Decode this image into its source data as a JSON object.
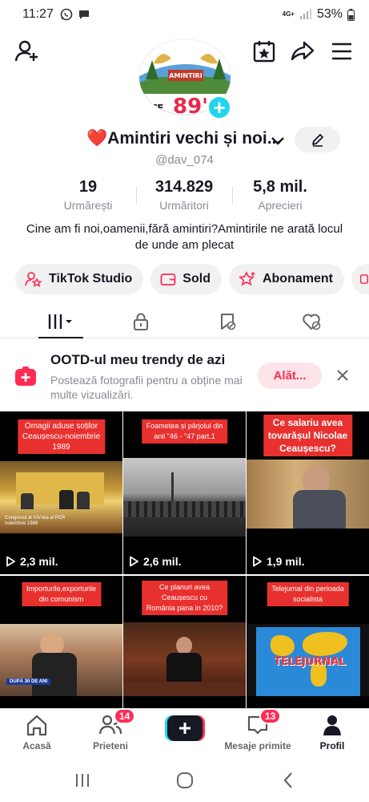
{
  "status_bar": {
    "time": "11:27",
    "network": "4G+",
    "battery": "53%"
  },
  "profile": {
    "display_name": "Amintiri vechi și noi...",
    "name_emoji": "❤️",
    "username": "@dav_074",
    "avatar_text": "89'",
    "avatar_sub": "NTE",
    "avatar_banner": "AMINTIRI",
    "bio": "Cine am fi noi,oamenii,fără amintiri?Amintirile ne arată locul de unde am plecat"
  },
  "stats": [
    {
      "value": "19",
      "label": "Urmărești"
    },
    {
      "value": "314.829",
      "label": "Urmăritori"
    },
    {
      "value": "5,8 mil.",
      "label": "Aprecieri"
    }
  ],
  "chips": [
    {
      "label": "TikTok Studio",
      "icon": "person-star-icon"
    },
    {
      "label": "Sold",
      "icon": "wallet-icon"
    },
    {
      "label": "Abonament",
      "icon": "star-plus-icon"
    }
  ],
  "promo": {
    "title": "OOTD-ul meu trendy de azi",
    "subtitle": "Postează fotografii pentru a obține mai multe vizualizări.",
    "button": "Alăt..."
  },
  "videos": [
    {
      "caption": "Omagii aduse soților\nCeaușescu-noiembrie\n1989",
      "views": "2,3 mil.",
      "scene_text": "Congresul al XIV-lea al PCR\nnoiembrie 1989"
    },
    {
      "caption": "Foametea și pârjolul din\nanii \"46 - \"47 part.1",
      "views": "2,6 mil."
    },
    {
      "caption": "Ce salariu avea\ntovarășul Nicolae\nCeaușescu?",
      "views": "1,9 mil."
    },
    {
      "caption": "Importurile,exporturile\ndin comunism",
      "views": "",
      "scene_text": "DUPĂ 30 DE ANI"
    },
    {
      "caption": "Ce planuri avea\nCeaușescu cu\nRomânia pana in 2010?",
      "views": ""
    },
    {
      "caption": "Telejurnal din perioada\nsocialista",
      "views": "",
      "scene_text": "TELEJURNAL"
    }
  ],
  "bottom_nav": [
    {
      "label": "Acasă",
      "icon": "home-icon"
    },
    {
      "label": "Prieteni",
      "icon": "friends-icon",
      "badge": "14"
    },
    {
      "label": "",
      "icon": "create-plus-icon"
    },
    {
      "label": "Mesaje primite",
      "icon": "inbox-icon",
      "badge": "13"
    },
    {
      "label": "Profil",
      "icon": "profile-icon"
    }
  ],
  "colors": {
    "accent": "#fe2c55",
    "cyan": "#20d5ec",
    "caption_red": "#e8312f",
    "muted": "#8a8b91"
  }
}
